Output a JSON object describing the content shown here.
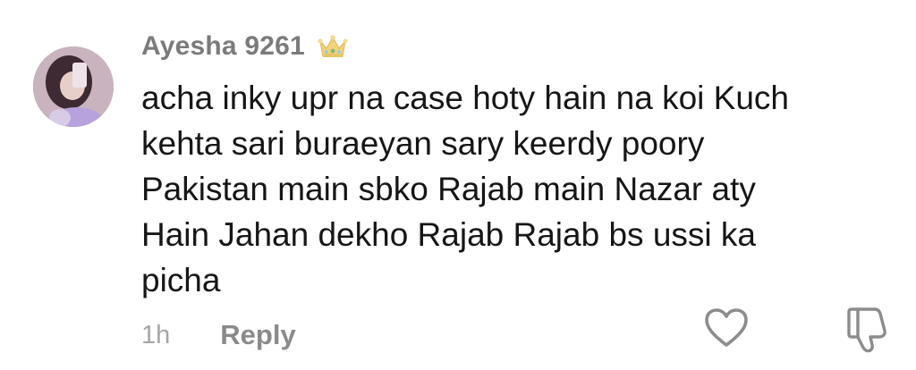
{
  "comment": {
    "author": "Ayesha 9261",
    "author_badge_icon": "crown-icon",
    "text_lines": [
      "acha inky upr na case hoty hain na koi Kuch",
      "kehta sari buraeyan sary keerdy poory",
      "Pakistan main sbko Rajab main Nazar aty",
      "Hain Jahan dekho Rajab Rajab bs ussi ka",
      "picha"
    ],
    "timestamp": "1h",
    "reply_label": "Reply",
    "like_icon": "heart-outline-icon",
    "dislike_icon": "thumbs-down-outline-icon"
  },
  "colors": {
    "author": "#7b7b7b",
    "text": "#161616",
    "timestamp": "#a6a6a6",
    "reply": "#8a8a8a",
    "crown": "#f0d37a"
  }
}
